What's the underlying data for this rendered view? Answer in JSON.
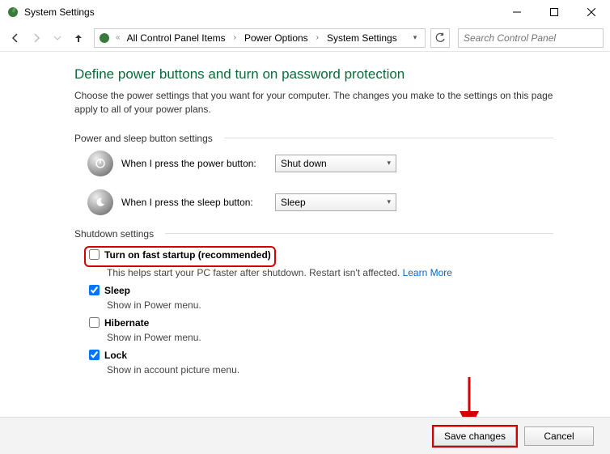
{
  "window": {
    "title": "System Settings"
  },
  "nav": {
    "crumbs": [
      "All Control Panel Items",
      "Power Options",
      "System Settings"
    ],
    "search_placeholder": "Search Control Panel"
  },
  "page": {
    "title": "Define power buttons and turn on password protection",
    "description": "Choose the power settings that you want for your computer. The changes you make to the settings on this page apply to all of your power plans."
  },
  "section_buttons": {
    "header": "Power and sleep button settings",
    "power": {
      "label": "When I press the power button:",
      "value": "Shut down"
    },
    "sleep": {
      "label": "When I press the sleep button:",
      "value": "Sleep"
    }
  },
  "section_shutdown": {
    "header": "Shutdown settings",
    "fast": {
      "label": "Turn on fast startup (recommended)",
      "desc": "This helps start your PC faster after shutdown. Restart isn't affected.",
      "link": "Learn More"
    },
    "sleep": {
      "label": "Sleep",
      "desc": "Show in Power menu."
    },
    "hibernate": {
      "label": "Hibernate",
      "desc": "Show in Power menu."
    },
    "lock": {
      "label": "Lock",
      "desc": "Show in account picture menu."
    }
  },
  "footer": {
    "save": "Save changes",
    "cancel": "Cancel"
  }
}
